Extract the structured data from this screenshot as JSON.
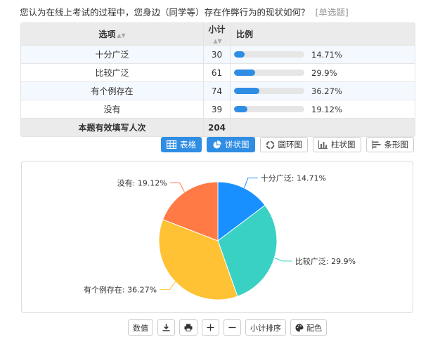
{
  "question": {
    "text": "您认为在线上考试的过程中，您身边（同学等）存在作弊行为的现状如何？",
    "type": "[单选题]"
  },
  "table": {
    "headers": {
      "option": "选项",
      "count": "小计",
      "ratio": "比例"
    },
    "rows": [
      {
        "label": "十分广泛",
        "count": "30",
        "pct_text": "14.71%",
        "pct": 14.71
      },
      {
        "label": "比较广泛",
        "count": "61",
        "pct_text": "29.9%",
        "pct": 29.9
      },
      {
        "label": "有个例存在",
        "count": "74",
        "pct_text": "36.27%",
        "pct": 36.27
      },
      {
        "label": "没有",
        "count": "39",
        "pct_text": "19.12%",
        "pct": 19.12
      }
    ],
    "total": {
      "label": "本题有效填写人次",
      "count": "204"
    }
  },
  "view_buttons": {
    "table": "表格",
    "pie": "饼状图",
    "ring": "圆环图",
    "column": "柱状图",
    "bar": "条形图",
    "active": "pie"
  },
  "chart_data": {
    "type": "pie",
    "slices": [
      {
        "label": "十分广泛",
        "value": 14.71,
        "text": "十分广泛: 14.71%",
        "color": "#1890ff"
      },
      {
        "label": "比较广泛",
        "value": 29.9,
        "text": "比较广泛: 29.9%",
        "color": "#3ad1c5"
      },
      {
        "label": "有个例存在",
        "value": 36.27,
        "text": "有个例存在: 36.27%",
        "color": "#ffc234"
      },
      {
        "label": "没有",
        "value": 19.12,
        "text": "没有: 19.12%",
        "color": "#ff7a45"
      }
    ]
  },
  "toolbar": {
    "value": "数值",
    "sort": "小计排序",
    "color": "配色"
  },
  "colors": {
    "accent": "#2f8de4"
  }
}
